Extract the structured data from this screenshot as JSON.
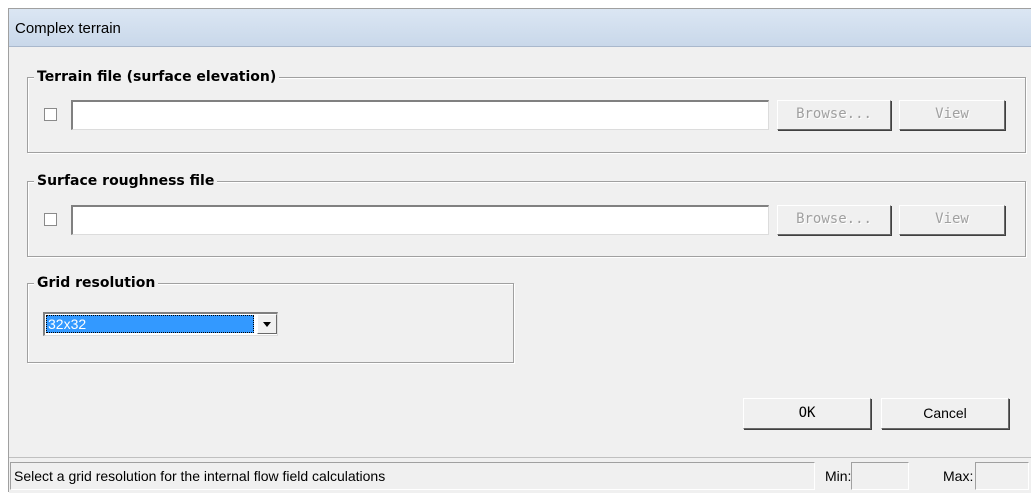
{
  "window": {
    "title": "Complex terrain"
  },
  "terrain_group": {
    "legend": "Terrain file (surface elevation)",
    "path_value": "",
    "browse_label": "Browse...",
    "view_label": "View"
  },
  "roughness_group": {
    "legend": "Surface roughness file",
    "path_value": "",
    "browse_label": "Browse...",
    "view_label": "View"
  },
  "grid_group": {
    "legend": "Grid resolution",
    "selected": "32x32"
  },
  "buttons": {
    "ok_label": "OK",
    "cancel_label": "Cancel"
  },
  "statusbar": {
    "message": "Select a grid resolution for the internal flow field calculations",
    "min_label": "Min:",
    "min_value": "",
    "max_label": "Max:",
    "max_value": ""
  }
}
